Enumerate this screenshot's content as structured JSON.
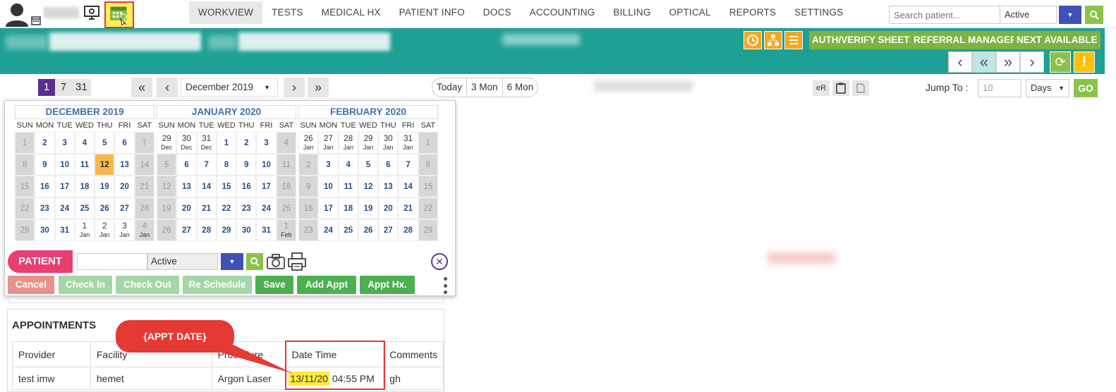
{
  "nav": {
    "items": [
      "WORKVIEW",
      "TESTS",
      "MEDICAL HX",
      "PATIENT INFO",
      "DOCS",
      "ACCOUNTING",
      "BILLING",
      "OPTICAL",
      "REPORTS",
      "SETTINGS"
    ]
  },
  "search": {
    "placeholder": "Search patient...",
    "status": "Active"
  },
  "banner": {
    "buttons": [
      "AUTH/VERIFY SHEET",
      "REFERRAL MANAGER",
      "NEXT AVAILABLE"
    ]
  },
  "toolbar": {
    "views": [
      "1",
      "7",
      "31"
    ],
    "month": "December 2019",
    "ranges": [
      "Today",
      "3 Mon",
      "6 Mon"
    ],
    "er_label": "eR",
    "jump_label": "Jump To :",
    "jump_value": "10",
    "jump_unit": "Days",
    "go_label": "GO"
  },
  "calendars": [
    {
      "title": "DECEMBER 2019",
      "dow": [
        "SUN",
        "MON",
        "TUE",
        "WED",
        "THU",
        "FRI",
        "SAT"
      ],
      "cells": [
        {
          "d": "1",
          "t": "wk"
        },
        {
          "d": "2"
        },
        {
          "d": "3"
        },
        {
          "d": "4"
        },
        {
          "d": "5"
        },
        {
          "d": "6"
        },
        {
          "d": "7",
          "t": "wk"
        },
        {
          "d": "8",
          "t": "wk"
        },
        {
          "d": "9"
        },
        {
          "d": "10"
        },
        {
          "d": "11"
        },
        {
          "d": "12",
          "t": "today"
        },
        {
          "d": "13"
        },
        {
          "d": "14",
          "t": "wk"
        },
        {
          "d": "15",
          "t": "wk"
        },
        {
          "d": "16"
        },
        {
          "d": "17"
        },
        {
          "d": "18"
        },
        {
          "d": "19"
        },
        {
          "d": "20"
        },
        {
          "d": "21",
          "t": "wk"
        },
        {
          "d": "22",
          "t": "wk"
        },
        {
          "d": "23"
        },
        {
          "d": "24"
        },
        {
          "d": "25"
        },
        {
          "d": "26"
        },
        {
          "d": "27"
        },
        {
          "d": "28",
          "t": "wk"
        },
        {
          "d": "29",
          "t": "wk"
        },
        {
          "d": "30"
        },
        {
          "d": "31"
        },
        {
          "d": "1",
          "m": "Jan",
          "t": "other"
        },
        {
          "d": "2",
          "m": "Jan",
          "t": "other"
        },
        {
          "d": "3",
          "m": "Jan",
          "t": "other"
        },
        {
          "d": "4",
          "m": "Jan",
          "t": "wk"
        }
      ]
    },
    {
      "title": "JANUARY 2020",
      "dow": [
        "SUN",
        "MON",
        "TUE",
        "WED",
        "THU",
        "FRI",
        "SAT"
      ],
      "cells": [
        {
          "d": "29",
          "m": "Dec",
          "t": "other"
        },
        {
          "d": "30",
          "m": "Dec",
          "t": "other"
        },
        {
          "d": "31",
          "m": "Dec",
          "t": "other"
        },
        {
          "d": "1"
        },
        {
          "d": "2"
        },
        {
          "d": "3"
        },
        {
          "d": "4",
          "t": "wk"
        },
        {
          "d": "5",
          "t": "wk"
        },
        {
          "d": "6"
        },
        {
          "d": "7"
        },
        {
          "d": "8"
        },
        {
          "d": "9"
        },
        {
          "d": "10"
        },
        {
          "d": "11",
          "t": "wk"
        },
        {
          "d": "12",
          "t": "wk"
        },
        {
          "d": "13"
        },
        {
          "d": "14"
        },
        {
          "d": "15"
        },
        {
          "d": "16"
        },
        {
          "d": "17"
        },
        {
          "d": "18",
          "t": "wk"
        },
        {
          "d": "19",
          "t": "wk"
        },
        {
          "d": "20"
        },
        {
          "d": "21"
        },
        {
          "d": "22"
        },
        {
          "d": "23"
        },
        {
          "d": "24"
        },
        {
          "d": "25",
          "t": "wk"
        },
        {
          "d": "26",
          "t": "wk"
        },
        {
          "d": "27"
        },
        {
          "d": "28"
        },
        {
          "d": "29"
        },
        {
          "d": "30"
        },
        {
          "d": "31"
        },
        {
          "d": "1",
          "m": "Feb",
          "t": "wk"
        }
      ]
    },
    {
      "title": "FEBRUARY 2020",
      "dow": [
        "SUN",
        "MON",
        "TUE",
        "WED",
        "THU",
        "FRI",
        "SAT"
      ],
      "cells": [
        {
          "d": "26",
          "m": "Jan",
          "t": "other"
        },
        {
          "d": "27",
          "m": "Jan",
          "t": "other"
        },
        {
          "d": "28",
          "m": "Jan",
          "t": "other"
        },
        {
          "d": "29",
          "m": "Jan",
          "t": "other"
        },
        {
          "d": "30",
          "m": "Jan",
          "t": "other"
        },
        {
          "d": "31",
          "m": "Jan",
          "t": "other"
        },
        {
          "d": "1",
          "t": "wk"
        },
        {
          "d": "2",
          "t": "wk"
        },
        {
          "d": "3"
        },
        {
          "d": "4"
        },
        {
          "d": "5"
        },
        {
          "d": "6"
        },
        {
          "d": "7"
        },
        {
          "d": "8",
          "t": "wk"
        },
        {
          "d": "9",
          "t": "wk"
        },
        {
          "d": "10"
        },
        {
          "d": "11"
        },
        {
          "d": "12"
        },
        {
          "d": "13"
        },
        {
          "d": "14"
        },
        {
          "d": "15",
          "t": "wk"
        },
        {
          "d": "16",
          "t": "wk"
        },
        {
          "d": "17"
        },
        {
          "d": "18"
        },
        {
          "d": "19"
        },
        {
          "d": "20"
        },
        {
          "d": "21"
        },
        {
          "d": "22",
          "t": "wk"
        },
        {
          "d": "23",
          "t": "wk"
        },
        {
          "d": "24"
        },
        {
          "d": "25"
        },
        {
          "d": "26"
        },
        {
          "d": "27"
        },
        {
          "d": "28"
        },
        {
          "d": "29",
          "t": "wk"
        }
      ]
    }
  ],
  "patient": {
    "label": "PATIENT",
    "status": "Active"
  },
  "actions": [
    "Cancel",
    "Check In",
    "Check Out",
    "Re Schedule",
    "Save",
    "Add Appt",
    "Appt Hx."
  ],
  "appointments": {
    "title": "APPOINTMENTS",
    "headers": [
      "Provider",
      "Facility",
      "Procedure",
      "Date Time",
      "Comments"
    ],
    "row": {
      "provider": "test imw",
      "facility": "hemet",
      "procedure": "Argon Laser",
      "date": "13/11/20",
      "time": "04:55 PM",
      "comments": "gh"
    }
  },
  "callout": {
    "label": "{APPT DATE}"
  },
  "colors": {
    "teal": "#1ea094",
    "green": "#7cb342",
    "purple": "#5c2d91",
    "pink": "#e83e72",
    "highlight": "#ffeb3b",
    "annotation_red": "#e53935"
  }
}
